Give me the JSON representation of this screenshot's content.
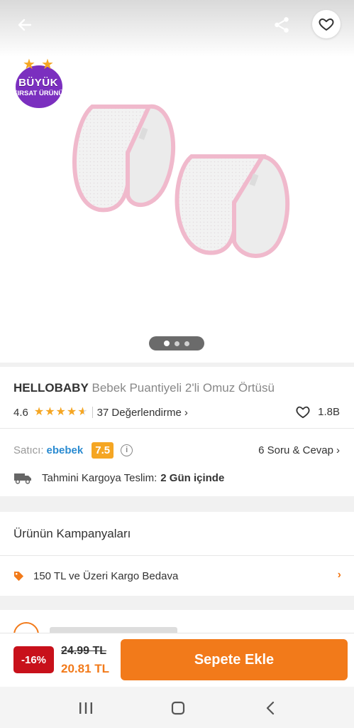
{
  "header": {
    "back_icon": "arrow-left-icon",
    "share_icon": "share-icon",
    "favorite_icon": "heart-icon"
  },
  "badge": {
    "line1": "BÜYÜK",
    "line2": "FIRSAT ÜRÜNÜ"
  },
  "carousel": {
    "count": 3,
    "active": 0
  },
  "product": {
    "brand": "HELLOBABY",
    "name": "Bebek Puantiyeli 2'li Omuz Örtüsü",
    "rating": "4.6",
    "stars": 4.6,
    "reviews": "37 Değerlendirme",
    "likes": "1.8B"
  },
  "seller": {
    "label": "Satıcı:",
    "name": "ebebek",
    "score": "7.5",
    "qa": "6 Soru & Cevap"
  },
  "delivery": {
    "label": "Tahmini Kargoya Teslim:",
    "value": "2 Gün içinde"
  },
  "campaigns": {
    "title": "Ürünün Kampanyaları",
    "items": [
      {
        "label": "150 TL ve Üzeri Kargo Bedava"
      }
    ]
  },
  "bottom": {
    "discount": "-16%",
    "old_price": "24.99 TL",
    "new_price": "20.81 TL",
    "add_to_cart": "Sepete Ekle"
  },
  "colors": {
    "accent": "#f27a1a",
    "discount": "#c8111b",
    "seller_link": "#2a8bd1",
    "star": "#f5a623",
    "badge": "#7b2fbf"
  }
}
